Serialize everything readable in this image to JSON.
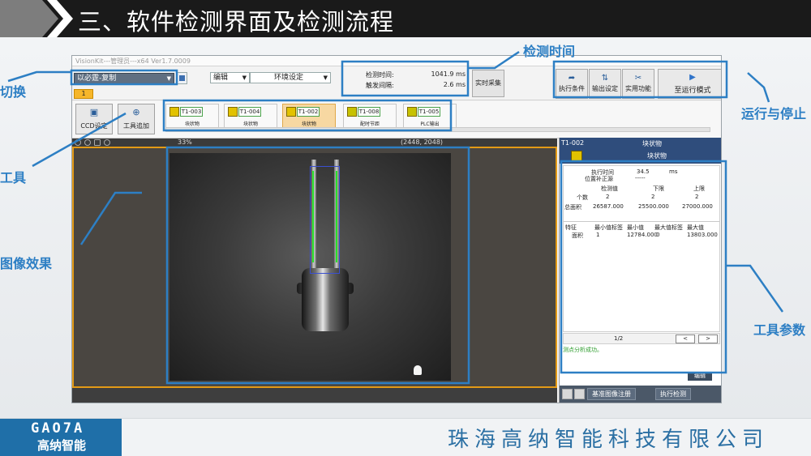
{
  "slide": {
    "title": "三、软件检测界面及检测流程",
    "company": "珠海高纳智能科技有限公司",
    "logo_en": "GAO7A",
    "logo_cn": "高纳智能",
    "accent_color": "#2d7fc4"
  },
  "annotations": {
    "switch": "切换",
    "detect_time": "检测时间",
    "run_stop": "运行与停止",
    "tools": "工具",
    "image_effect": "图像效果",
    "tool_params": "工具参数"
  },
  "app": {
    "window_title": "VisionKit---管理员---x64 Ver1.7.0009",
    "program_select": "以必霆-复制",
    "program_tab": "1",
    "edit_menu": "编辑",
    "env_menu": "环境设定",
    "detect_time_label": "检测时间:",
    "detect_time_value": "1041.9 ms",
    "trigger_label": "触发间隔:",
    "trigger_value": "2.6 ms",
    "live_button": "实时采集",
    "buttons": {
      "exec_cond": "执行条件",
      "output_set": "输出设定",
      "util": "实用功能",
      "run_mode": "至运行模式"
    },
    "ccd_button": "CCD设定",
    "tool_add_button": "工具追加",
    "tools": [
      {
        "id": "T1-003",
        "name": "块状物",
        "icon": "blob-tool-icon"
      },
      {
        "id": "T1-004",
        "name": "块状物",
        "icon": "blob-tool-icon"
      },
      {
        "id": "T1-002",
        "name": "块状物",
        "icon": "blob-tool-icon"
      },
      {
        "id": "T1-008",
        "name": "配时节距",
        "icon": "timing-tool-icon"
      },
      {
        "id": "T1-005",
        "name": "PLC输出",
        "icon": "plc-tool-icon"
      }
    ],
    "zoom": "33%",
    "resolution": "(2448, 2048)"
  },
  "panel": {
    "tool_id": "T1-002",
    "tool_name": "块状物",
    "tool_subname": "块状物",
    "exec_time_label": "执行时间",
    "exec_time_value": "34.5",
    "exec_time_unit": "ms",
    "pos_comp_label": "位置补正源",
    "pos_comp_value": "-----",
    "col_headers": [
      "检测值",
      "下限",
      "上限"
    ],
    "rows": [
      {
        "label": "个数",
        "values": [
          "2",
          "2",
          "2"
        ]
      },
      {
        "label": "总面积",
        "values": [
          "26587.000",
          "25500.000",
          "27000.000"
        ]
      }
    ],
    "feature_headers": [
      "特征",
      "最小值标签",
      "最小值",
      "最大值标签",
      "最大值"
    ],
    "feature_rows": [
      {
        "cells": [
          "面积",
          "1",
          "12784.000",
          "0",
          "13803.000"
        ]
      }
    ],
    "page": "1/2",
    "prev": "<",
    "next": ">",
    "log": "测点分析成功。",
    "edit": "编辑",
    "ref_image": "基准图像注册",
    "exec_detect": "执行检测"
  }
}
